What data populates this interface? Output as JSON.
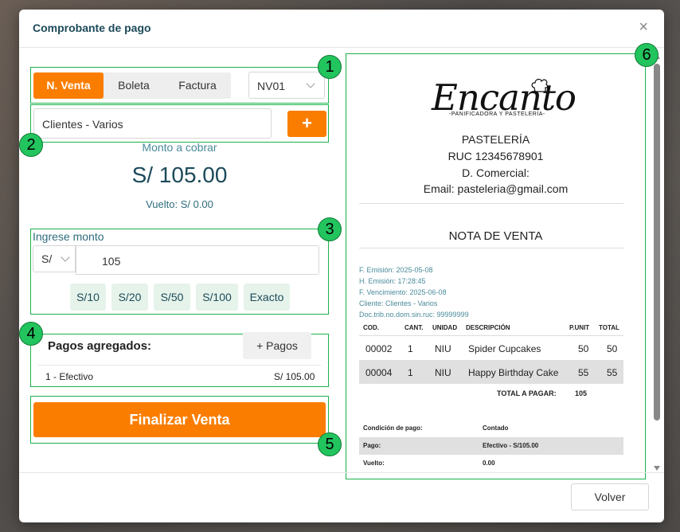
{
  "modal": {
    "title": "Comprobante de pago",
    "close_icon": "close-icon"
  },
  "doc_types": {
    "items": [
      "N. Venta",
      "Boleta",
      "Factura"
    ],
    "active": "N. Venta"
  },
  "serie": {
    "value": "NV01"
  },
  "client": {
    "value": "Clientes - Varios",
    "add_label": "+"
  },
  "amount_due": {
    "label": "Monto a cobrar",
    "value": "S/ 105.00",
    "change": "Vuelto: S/ 0.00"
  },
  "payment_input": {
    "label": "Ingrese monto",
    "currency": "S/",
    "amount": "105",
    "quick_buttons": [
      "S/10",
      "S/20",
      "S/50",
      "S/100",
      "Exacto"
    ]
  },
  "payments": {
    "title": "Pagos agregados:",
    "add_label": "+ Pagos",
    "items": [
      {
        "method": "1 - Efectivo",
        "amount": "S/ 105.00"
      }
    ]
  },
  "finalize_label": "Finalizar Venta",
  "back_label": "Volver",
  "annotations": [
    "1",
    "2",
    "3",
    "4",
    "5",
    "6"
  ],
  "receipt": {
    "brand": "Encanto",
    "brand_sub": "-PANIFICADORA Y PASTELERÍA-",
    "business_type": "PASTELERÍA",
    "ruc": "RUC 12345678901",
    "commercial": "D. Comercial:",
    "email": "Email: pasteleria@gmail.com",
    "doc_title": "NOTA DE VENTA",
    "meta": [
      "F. Emisión: 2025-05-08",
      "H. Emisión: 17:28:45",
      "F. Vencimiento: 2025-06-08",
      "Cliente: Clientes - Varios",
      "Doc.trib.no.dom.sin.ruc: 99999999"
    ],
    "columns": [
      "COD.",
      "CANT.",
      "UNIDAD",
      "DESCRIPCIÓN",
      "P.UNIT",
      "TOTAL"
    ],
    "rows": [
      {
        "cod": "00002",
        "cant": "1",
        "unidad": "NIU",
        "desc": "Spider Cupcakes",
        "punit": "50",
        "total": "50"
      },
      {
        "cod": "00004",
        "cant": "1",
        "unidad": "NIU",
        "desc": "Happy Birthday Cake",
        "punit": "55",
        "total": "55"
      }
    ],
    "total_label": "TOTAL A PAGAR:",
    "total_value": "105",
    "payment_info": [
      {
        "label": "Condición de pago:",
        "value": "Contado"
      },
      {
        "label": "Pago:",
        "value": "Efectivo - S/105.00"
      },
      {
        "label": "Vuelto:",
        "value": "0.00"
      }
    ]
  },
  "colors": {
    "accent": "#fa7d00",
    "annotation": "#22c45e",
    "title": "#1c4a5a"
  }
}
